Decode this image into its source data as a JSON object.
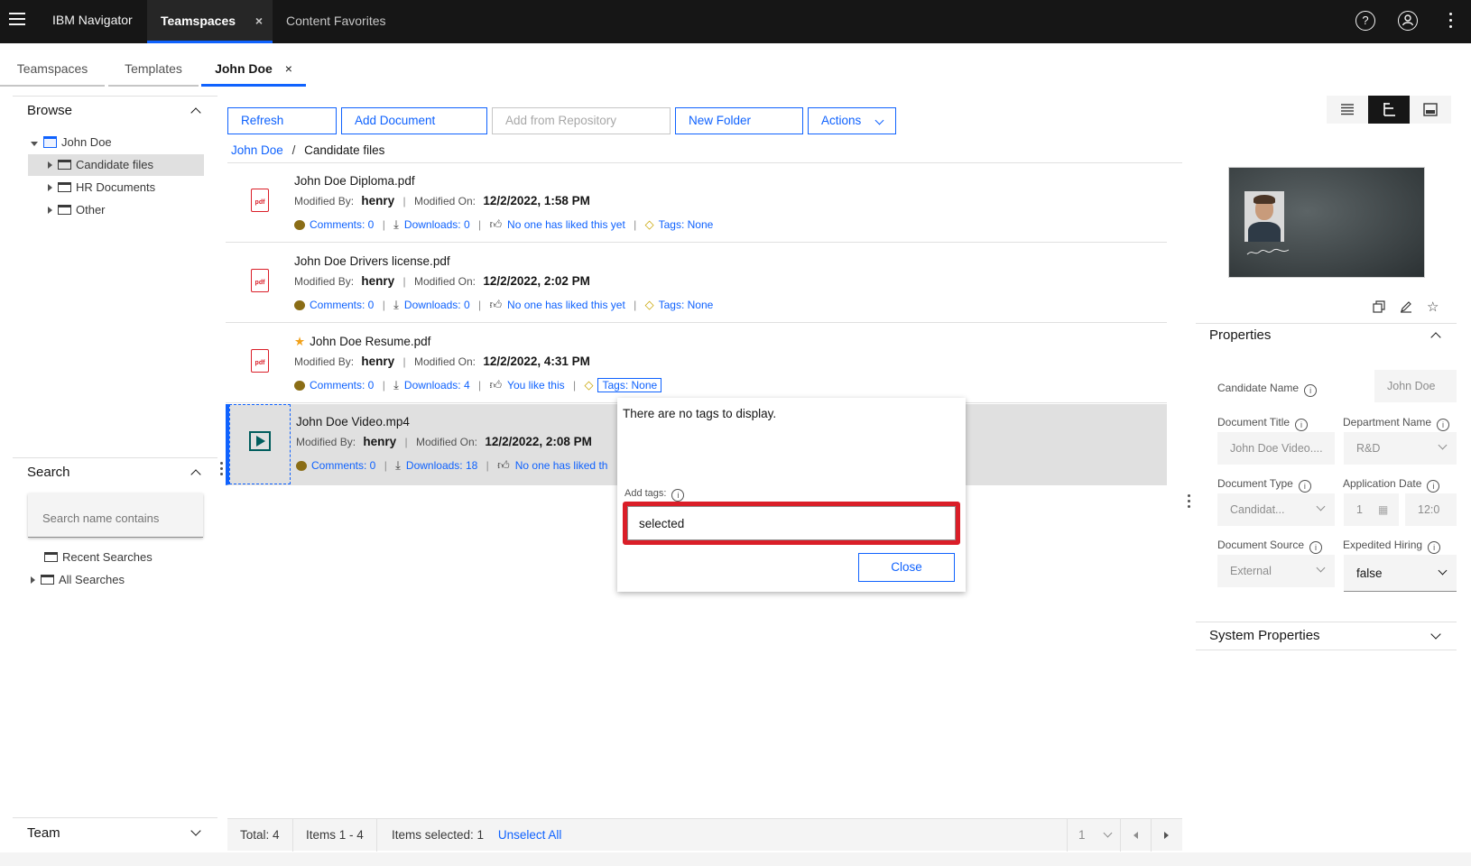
{
  "topbar": {
    "brand": "IBM Navigator",
    "tabs": [
      {
        "label": "Teamspaces",
        "active": true
      },
      {
        "label": "Content Favorites",
        "active": false
      }
    ],
    "close_glyph": "×"
  },
  "subtabs": [
    {
      "label": "Teamspaces"
    },
    {
      "label": "Templates"
    },
    {
      "label": "John Doe",
      "active": true
    }
  ],
  "browse": {
    "title": "Browse",
    "root": "John Doe",
    "items": [
      "Candidate files",
      "HR Documents",
      "Other"
    ]
  },
  "search": {
    "title": "Search",
    "placeholder": "Search name contains",
    "items": [
      "Recent Searches",
      "All Searches"
    ]
  },
  "team": {
    "title": "Team"
  },
  "toolbar": {
    "refresh": "Refresh",
    "add_document": "Add Document",
    "add_from_repository": "Add from Repository",
    "new_folder": "New Folder",
    "actions": "Actions"
  },
  "breadcrumb": {
    "root": "John Doe",
    "sep": "/",
    "current": "Candidate files"
  },
  "labels": {
    "modified_by": "Modified By:",
    "modified_on": "Modified On:"
  },
  "documents": [
    {
      "name": "John Doe Diploma.pdf",
      "by": "henry",
      "on": "12/2/2022, 1:58 PM",
      "comments": "Comments: 0",
      "downloads": "Downloads: 0",
      "likes": "No one has liked this yet",
      "tags": "Tags: None"
    },
    {
      "name": "John Doe Drivers license.pdf",
      "by": "henry",
      "on": "12/2/2022, 2:02 PM",
      "comments": "Comments: 0",
      "downloads": "Downloads: 0",
      "likes": "No one has liked this yet",
      "tags": "Tags: None"
    },
    {
      "name": "John Doe Resume.pdf",
      "by": "henry",
      "on": "12/2/2022, 4:31 PM",
      "comments": "Comments: 0",
      "downloads": "Downloads: 4",
      "likes": "You like this",
      "tags": "Tags: None"
    },
    {
      "name": "John Doe Video.mp4",
      "by": "henry",
      "on": "12/2/2022, 2:08 PM",
      "comments": "Comments: 0",
      "downloads": "Downloads: 18",
      "likes": "No one has liked th"
    }
  ],
  "popover": {
    "empty": "There are no tags to display.",
    "add_label": "Add tags:",
    "input_value": "selected",
    "close": "Close"
  },
  "properties": {
    "title": "Properties",
    "candidate_name_label": "Candidate Name",
    "candidate_name": "John Doe",
    "document_title_label": "Document Title",
    "document_title": "John Doe Video....",
    "department_name_label": "Department Name",
    "department_name": "R&D",
    "document_type_label": "Document Type",
    "document_type": "Candidat...",
    "application_date_label": "Application Date",
    "application_date": "1",
    "application_time": "12:0",
    "document_source_label": "Document Source",
    "document_source": "External",
    "expedited_hiring_label": "Expedited Hiring",
    "expedited_hiring": "false",
    "system_properties": "System Properties"
  },
  "pager": {
    "total": "Total: 4",
    "items": "Items 1 - 4",
    "selected": "Items selected: 1",
    "unselect": "Unselect All",
    "page": "1"
  },
  "colors": {
    "accent": "#0f62fe",
    "danger": "#da1e28",
    "topbar": "#161616"
  }
}
